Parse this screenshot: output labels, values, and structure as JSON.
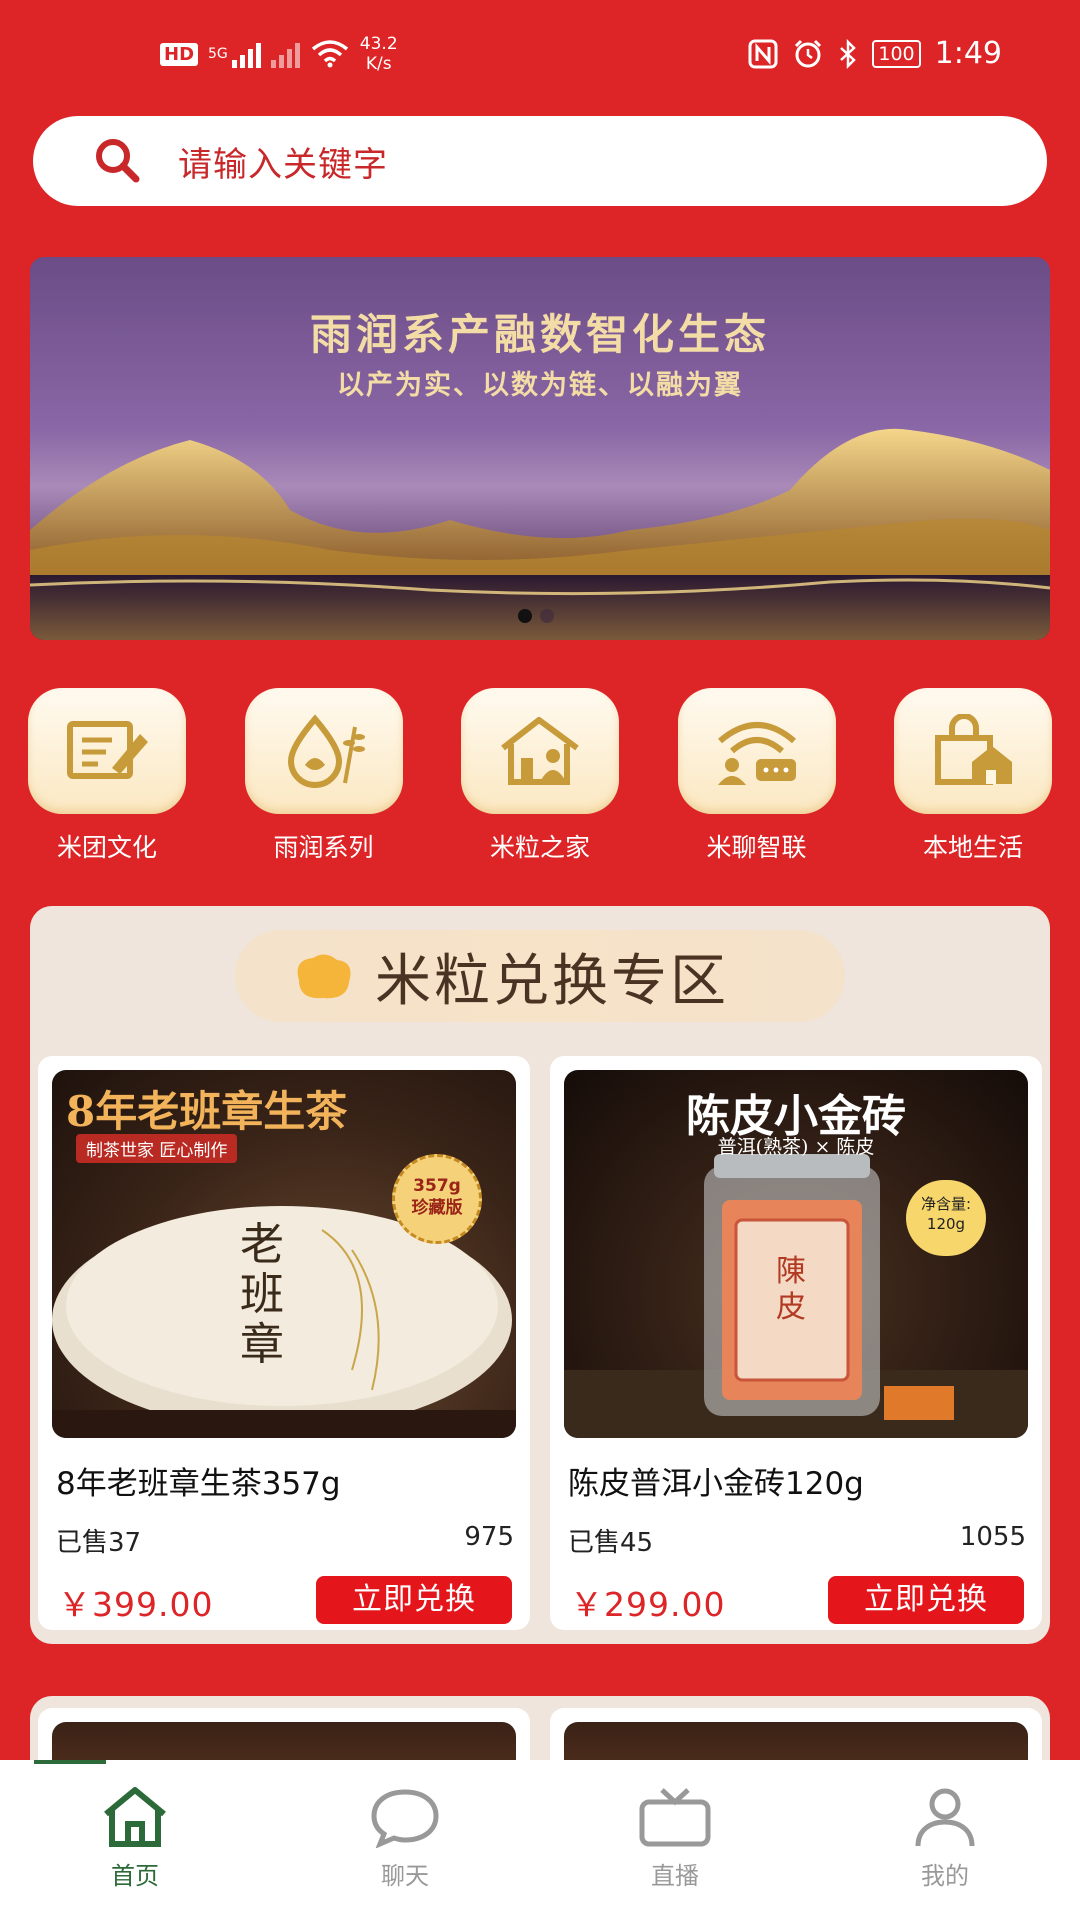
{
  "status_bar": {
    "hd": "HD",
    "signal": "5G",
    "net_speed_value": "43.2",
    "net_speed_unit": "K/s",
    "battery": "100",
    "time": "1:49"
  },
  "search": {
    "placeholder": "请输入关键字"
  },
  "banner": {
    "title": "雨润系产融数智化生态",
    "subtitle": "以产为实、以数为链、以融为翼",
    "active_dot": 1,
    "dot_count": 2
  },
  "nav_items": [
    {
      "label": "米团文化",
      "icon": "notebook-pen-icon"
    },
    {
      "label": "雨润系列",
      "icon": "water-drop-wheat-icon"
    },
    {
      "label": "米粒之家",
      "icon": "house-person-icon"
    },
    {
      "label": "米聊智联",
      "icon": "wifi-chat-icon"
    },
    {
      "label": "本地生活",
      "icon": "shopping-bag-house-icon"
    }
  ],
  "exchange_zone": {
    "title": "米粒兑换专区",
    "products": [
      {
        "image_title": "8年老班章生茶",
        "image_tag": "制茶世家  匠心制作",
        "image_badge_1": "357g",
        "image_badge_2": "珍藏版",
        "image_cake_text": "老班章",
        "name": "8年老班章生茶357g",
        "sold": "已售37",
        "count": "975",
        "price": "￥399.00",
        "button": "立即兑换"
      },
      {
        "image_title": "陈皮小金砖",
        "image_subtitle": "普洱(熟茶) × 陈皮",
        "image_badge_1": "净含量:",
        "image_badge_2": "120g",
        "image_jar_text": "陳皮",
        "name": "陈皮普洱小金砖120g",
        "sold": "已售45",
        "count": "1055",
        "price": "￥299.00",
        "button": "立即兑换"
      }
    ]
  },
  "tab_bar": [
    {
      "label": "首页",
      "icon": "home-icon",
      "active": true
    },
    {
      "label": "聊天",
      "icon": "chat-bubble-icon",
      "active": false
    },
    {
      "label": "直播",
      "icon": "tv-icon",
      "active": false
    },
    {
      "label": "我的",
      "icon": "user-icon",
      "active": false
    }
  ],
  "colors": {
    "brand_red": "#dd2426",
    "button_red": "#e4161b",
    "gold": "#f3dca5",
    "active_tab_green": "#2d6a3a"
  }
}
